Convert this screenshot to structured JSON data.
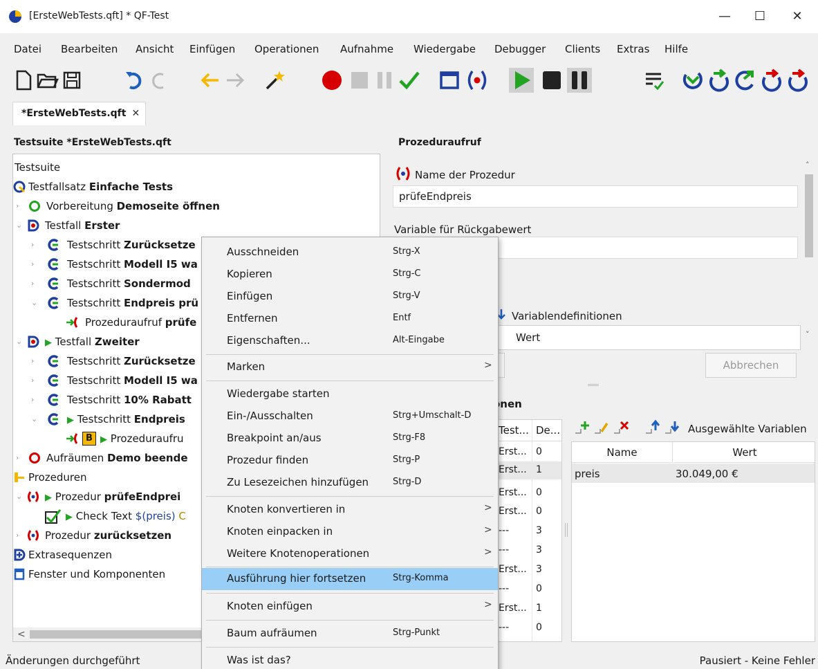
{
  "window": {
    "title": "[ErsteWebTests.qft] * QF-Test",
    "min": "—",
    "max": "☐",
    "close": "✕"
  },
  "menubar": [
    "Datei",
    "Bearbeiten",
    "Ansicht",
    "Einfügen",
    "Operationen",
    "Aufnahme",
    "Wiedergabe",
    "Debugger",
    "Clients",
    "Extras",
    "Hilfe"
  ],
  "tab": {
    "label": "*ErsteWebTests.qft",
    "close": "✕"
  },
  "left_panel": {
    "title": "Testsuite *ErsteWebTests.qft",
    "tree": [
      {
        "prefix": "Testsuite",
        "bold": ""
      },
      {
        "prefix": "Testfallsatz ",
        "bold": "Einfache Tests"
      },
      {
        "prefix": "Vorbereitung ",
        "bold": "Demoseite öffnen"
      },
      {
        "prefix": "Testfall ",
        "bold": "Erster"
      },
      {
        "prefix": "Testschritt ",
        "bold": "Zurücksetze"
      },
      {
        "prefix": "Testschritt ",
        "bold": "Modell I5 wa"
      },
      {
        "prefix": "Testschritt ",
        "bold": "Sondermod"
      },
      {
        "prefix": "Testschritt ",
        "bold": "Endpreis prü"
      },
      {
        "prefix": "Prozeduraufruf ",
        "bold": "prüfe"
      },
      {
        "prefix": "Testfall ",
        "bold": "Zweiter"
      },
      {
        "prefix": "Testschritt ",
        "bold": "Zurücksetze"
      },
      {
        "prefix": "Testschritt ",
        "bold": "Modell I5 wa"
      },
      {
        "prefix": "Testschritt ",
        "bold": "10% Rabatt"
      },
      {
        "prefix": "Testschritt ",
        "bold": "Endpreis"
      },
      {
        "prefix": "Prozeduraufru",
        "bold": ""
      },
      {
        "prefix": "Aufräumen ",
        "bold": "Demo beende"
      },
      {
        "prefix": "Prozeduren",
        "bold": ""
      },
      {
        "prefix": "Prozedur ",
        "bold": "prüfeEndprei"
      },
      {
        "prefix": "Check Text ",
        "bold": ""
      },
      {
        "prefix": "Prozedur ",
        "bold": "zurücksetzen"
      },
      {
        "prefix": "Extrasequenzen",
        "bold": ""
      },
      {
        "prefix": "Fenster und Komponenten",
        "bold": ""
      }
    ],
    "check_text_var": "$(preis)",
    "check_text_tail": "C",
    "breakpoint_badge": "B",
    "scroll_left": "<"
  },
  "right_panel": {
    "title": "Prozeduraufruf",
    "name_label": "Name der Prozedur",
    "name_value": "prüfeEndpreis",
    "retvar_label": "Variable für Rückgabewert",
    "retvar_value": "",
    "vardef_label": "Variablendefinitionen",
    "vardef_header_wert": "Wert",
    "cancel_button": "Abbrechen",
    "lower_title_fragment": "onen",
    "stack_table": {
      "headers": [
        "Test...",
        "De..."
      ],
      "rows": [
        [
          "Erst...",
          "0"
        ],
        [
          "Erst...",
          "1"
        ],
        [
          "Erst...",
          "0"
        ],
        [
          "Erst...",
          "0"
        ],
        [
          "---",
          "3"
        ],
        [
          "---",
          "3"
        ],
        [
          "Erst...",
          "3"
        ],
        [
          "---",
          "0"
        ],
        [
          "Erst...",
          "1"
        ],
        [
          "---",
          "0"
        ]
      ]
    },
    "selected_vars_label": "Ausgewählte Variablen",
    "vars_table": {
      "headers": [
        "Name",
        "Wert"
      ],
      "rows": [
        [
          "preis",
          "30.049,00 €"
        ]
      ]
    }
  },
  "context_menu": [
    {
      "label": "Ausschneiden",
      "shortcut": "Strg-X"
    },
    {
      "label": "Kopieren",
      "shortcut": "Strg-C"
    },
    {
      "label": "Einfügen",
      "shortcut": "Strg-V"
    },
    {
      "label": "Entfernen",
      "shortcut": "Entf"
    },
    {
      "label": "Eigenschaften...",
      "shortcut": "Alt-Eingabe"
    },
    {
      "label": "Marken",
      "shortcut": "",
      "sub": ">"
    },
    {
      "label": "Wiedergabe starten",
      "shortcut": ""
    },
    {
      "label": "Ein-/Ausschalten",
      "shortcut": "Strg+Umschalt-D"
    },
    {
      "label": "Breakpoint an/aus",
      "shortcut": "Strg-F8"
    },
    {
      "label": "Prozedur finden",
      "shortcut": "Strg-P"
    },
    {
      "label": "Zu Lesezeichen hinzufügen",
      "shortcut": "Strg-D"
    },
    {
      "label": "Knoten konvertieren in",
      "shortcut": "",
      "sub": ">"
    },
    {
      "label": "Knoten einpacken in",
      "shortcut": "",
      "sub": ">"
    },
    {
      "label": "Weitere Knotenoperationen",
      "shortcut": "",
      "sub": ">"
    },
    {
      "label": "Ausführung hier fortsetzen",
      "shortcut": "Strg-Komma"
    },
    {
      "label": "Knoten einfügen",
      "shortcut": "",
      "sub": ">"
    },
    {
      "label": "Baum aufräumen",
      "shortcut": "Strg-Punkt"
    },
    {
      "label": "Was ist das?",
      "shortcut": ""
    }
  ],
  "status": {
    "left": "Änderungen durchgeführt",
    "right": "Pausiert - Keine Fehler"
  },
  "colors": {
    "highlight": "#99cff7",
    "record_red": "#d60000",
    "green": "#22a322",
    "blue": "#1f5fbf",
    "orange": "#f5b800"
  }
}
